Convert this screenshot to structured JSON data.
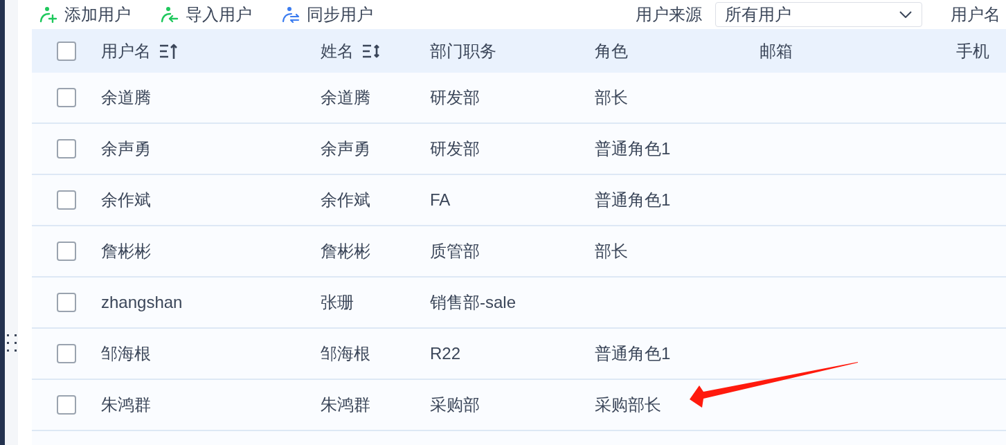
{
  "toolbar": {
    "actions": [
      {
        "label": "添加用户",
        "kind": "add"
      },
      {
        "label": "导入用户",
        "kind": "import"
      },
      {
        "label": "同步用户",
        "kind": "sync"
      }
    ],
    "source_filter": {
      "label": "用户来源",
      "value": "所有用户"
    },
    "username_filter": {
      "label": "用户名"
    }
  },
  "table": {
    "header_checked": false,
    "columns": [
      {
        "label": "用户名",
        "kind": "ascending"
      },
      {
        "label": "姓名",
        "kind": "sortable"
      },
      {
        "label": "部门职务",
        "kind": "plain"
      },
      {
        "label": "角色",
        "kind": "plain"
      },
      {
        "label": "邮箱",
        "kind": "plain"
      },
      {
        "label": "手机",
        "kind": "plain"
      }
    ],
    "rows": [
      {
        "checked": false,
        "username": "余道腾",
        "name": "余道腾",
        "department": "研发部",
        "role": "部长"
      },
      {
        "checked": false,
        "username": "余声勇",
        "name": "余声勇",
        "department": "研发部",
        "role": "普通角色1"
      },
      {
        "checked": false,
        "username": "余作斌",
        "name": "余作斌",
        "department": "FA",
        "role": "普通角色1"
      },
      {
        "checked": false,
        "username": "詹彬彬",
        "name": "詹彬彬",
        "department": "质管部",
        "role": "部长"
      },
      {
        "checked": false,
        "username": "zhangshan",
        "name": "张珊",
        "department": "销售部-sale"
      },
      {
        "checked": false,
        "username": "邹海根",
        "name": "邹海根",
        "department": "R22",
        "role": "普通角色1"
      },
      {
        "checked": false,
        "username": "朱鸿群",
        "name": "朱鸿群",
        "department": "采购部",
        "role": "采购部长"
      }
    ]
  }
}
